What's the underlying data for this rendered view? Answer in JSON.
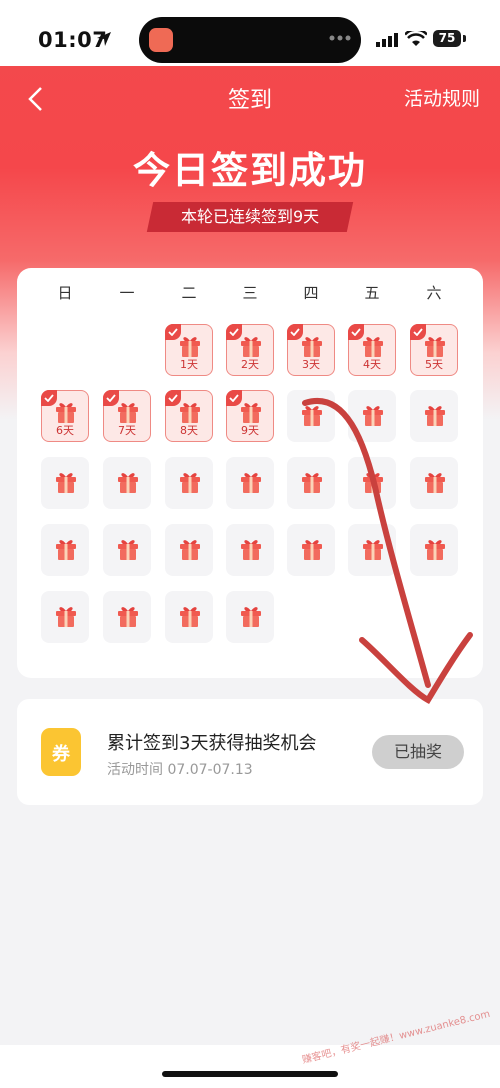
{
  "status_bar": {
    "time": "01:07",
    "battery": "75"
  },
  "nav": {
    "title": "签到",
    "rules": "活动规则"
  },
  "hero": {
    "success_title": "今日签到成功",
    "streak_text": "本轮已连续签到9天"
  },
  "calendar": {
    "weekdays": [
      "日",
      "一",
      "二",
      "三",
      "四",
      "五",
      "六"
    ],
    "day_labels": [
      "1天",
      "2天",
      "3天",
      "4天",
      "5天",
      "6天",
      "7天",
      "8天",
      "9天"
    ]
  },
  "reward": {
    "title": "累计签到3天获得抽奖机会",
    "time": "活动时间 07.07-07.13",
    "button": "已抽奖",
    "icon_text": "券"
  },
  "watermark": "赚客吧，有奖一起赚！www.zuanke8.com",
  "colors": {
    "brand_red": "#f24a4c",
    "coupon_yellow": "#fbc532",
    "annotation_red": "#c9413e"
  }
}
